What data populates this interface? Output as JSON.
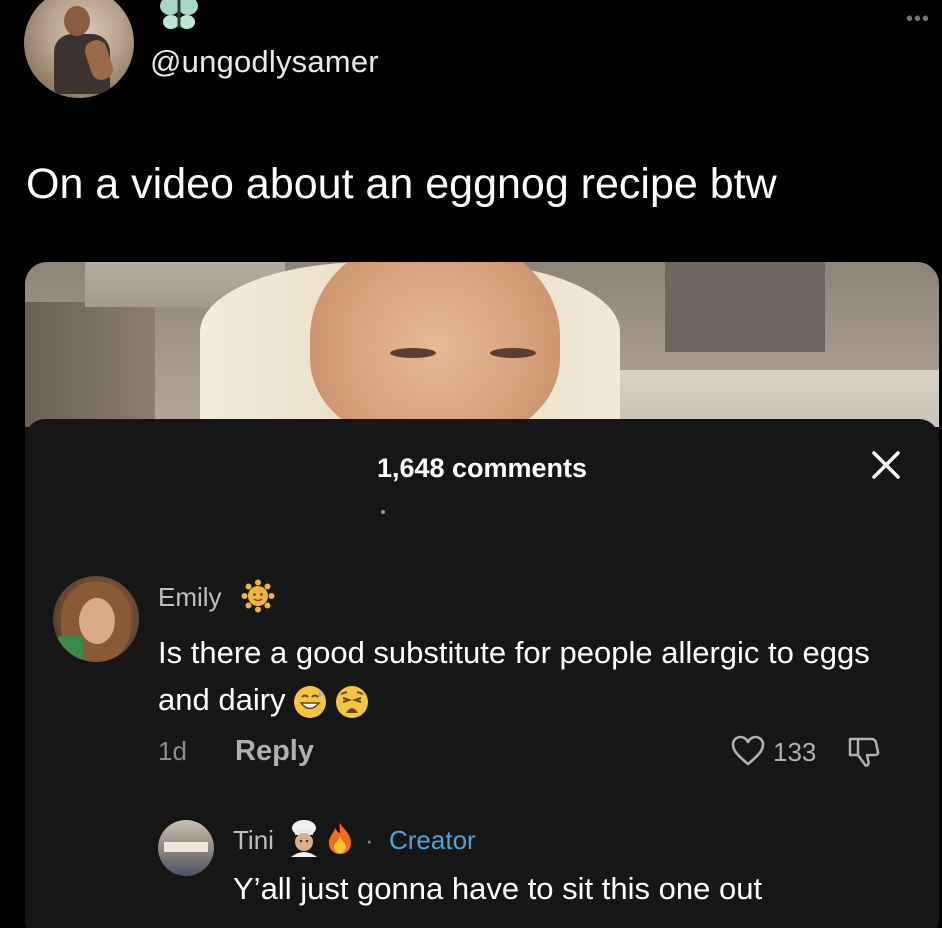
{
  "tweet": {
    "username": "@ungodlysamer",
    "text": "On a video about an eggnog recipe btw",
    "more_icon": "more-horizontal-icon"
  },
  "embedded_screenshot": {
    "comments_header": "1,648 comments",
    "close_icon": "close-icon",
    "comments": [
      {
        "author": "Emily",
        "author_badge_icon": "sun-emoji-icon",
        "text": "Is there a good substitute for people allergic to eggs and dairy",
        "text_emojis": [
          "grinning-sweat-emoji-icon",
          "weary-face-emoji-icon"
        ],
        "age": "1d",
        "reply_label": "Reply",
        "like_count": "133",
        "like_icon": "heart-icon",
        "dislike_icon": "thumbs-down-icon"
      }
    ],
    "reply": {
      "author": "Tini",
      "author_emojis": [
        "chef-emoji-icon",
        "fire-emoji-icon"
      ],
      "separator": "·",
      "role": "Creator",
      "text": "Y’all just gonna have to sit this one out"
    }
  },
  "colors": {
    "background": "#000000",
    "panel": "#161616",
    "creator_label": "#4fa3d6",
    "muted_text": "#8c8c8c"
  }
}
